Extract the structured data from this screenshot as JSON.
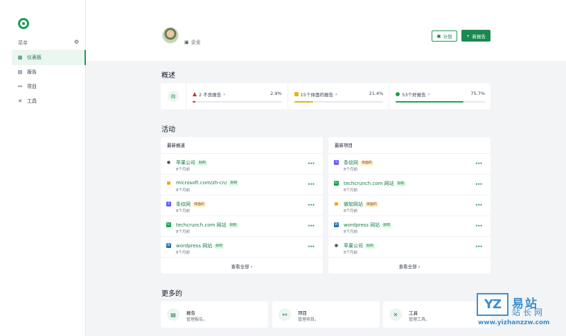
{
  "sidebar": {
    "menu_label": "菜单",
    "items": [
      {
        "label": "仪表板",
        "icon": "grid-icon",
        "glyph": "▦"
      },
      {
        "label": "报告",
        "icon": "report-icon",
        "glyph": "▤"
      },
      {
        "label": "项目",
        "icon": "project-icon",
        "glyph": "⚯"
      },
      {
        "label": "工具",
        "icon": "tools-icon",
        "glyph": "✕"
      }
    ]
  },
  "header": {
    "company_label": "企业",
    "plan_button": "计划",
    "new_report_button": "新报告"
  },
  "overview": {
    "title": "概述",
    "metrics": [
      {
        "label": "2 不良报告",
        "percent": "2.9%",
        "fraction": 0.029,
        "color": "#dc2626"
      },
      {
        "label": "15个体面的报告",
        "percent": "21.4%",
        "fraction": 0.214,
        "color": "#eab308"
      },
      {
        "label": "53个好报告",
        "percent": "75.7%",
        "fraction": 0.757,
        "color": "#16a34a"
      }
    ]
  },
  "activity": {
    "title": "活动",
    "left_panel": {
      "title": "最新报道",
      "rows": [
        {
          "name": "苹果公司",
          "badge": "好的",
          "badge_type": "good",
          "time": "8个月前",
          "icon": "apple-icon"
        },
        {
          "name": "microsoft.com/zh-cn/",
          "badge": "好的",
          "badge_type": "good",
          "time": "8个月前",
          "icon": "microsoft-icon"
        },
        {
          "name": "条纹网",
          "badge": "体面的",
          "badge_type": "warn",
          "time": "8个月前",
          "icon": "stripe-icon"
        },
        {
          "name": "techcrunch.com 网站",
          "badge": "好的",
          "badge_type": "good",
          "time": "8个月前",
          "icon": "techcrunch-icon"
        },
        {
          "name": "wordpress 网站",
          "badge": "好的",
          "badge_type": "good",
          "time": "8个月前",
          "icon": "wordpress-icon"
        }
      ],
      "view_all": "查看全部 ›"
    },
    "right_panel": {
      "title": "最新项目",
      "rows": [
        {
          "name": "条纹网",
          "badge": "体面的",
          "badge_type": "warn",
          "time": "8个月前",
          "icon": "stripe-icon"
        },
        {
          "name": "techcrunch.com 网站",
          "badge": "好的",
          "badge_type": "good",
          "time": "8个月前",
          "icon": "techcrunch-icon"
        },
        {
          "name": "微软网站",
          "badge": "体面的",
          "badge_type": "warn",
          "time": "8个月前",
          "icon": "microsoft-icon"
        },
        {
          "name": "wordpress 网站",
          "badge": "好的",
          "badge_type": "good",
          "time": "8个月前",
          "icon": "wordpress-icon"
        },
        {
          "name": "苹果公司",
          "badge": "好的",
          "badge_type": "good",
          "time": "8个月前",
          "icon": "apple-icon"
        }
      ],
      "view_all": "查看全部 ›"
    }
  },
  "more": {
    "title": "更多的",
    "cards": [
      {
        "title": "报告",
        "subtitle": "管理报告。",
        "icon": "report-icon"
      },
      {
        "title": "项目",
        "subtitle": "管理项目。",
        "icon": "project-icon"
      },
      {
        "title": "工具",
        "subtitle": "管理工具。",
        "icon": "tools-icon"
      }
    ]
  },
  "watermark": {
    "logo": "YZ",
    "name": "易站",
    "sub": "站长网",
    "url": "www.yizhanzzw.com"
  },
  "colors": {
    "accent": "#1a9a5a",
    "accent_dark": "#1a8a50"
  }
}
